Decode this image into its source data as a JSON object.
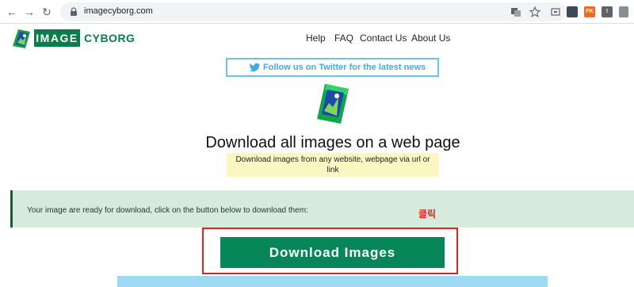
{
  "browser": {
    "url": "imagecyborg.com",
    "extensions": [
      {
        "name": "grammar-extension-icon",
        "label": "",
        "color": "#3c4a57"
      },
      {
        "name": "fk-extension-icon",
        "label": "FK",
        "color": "#f26b1d"
      },
      {
        "name": "info-extension-icon",
        "label": "!",
        "color": "#5f6368"
      },
      {
        "name": "shield-extension-icon",
        "label": "",
        "color": "#8a8d91"
      }
    ]
  },
  "site": {
    "logo_image": "IMAGE",
    "logo_cyborg": "CYBORG",
    "nav": [
      "Help",
      "FAQ",
      "Contact Us",
      "About Us"
    ]
  },
  "twitter": {
    "text": "Follow us on Twitter for the latest news"
  },
  "hero": {
    "title": "Download all images on a web page",
    "subtitle": "Download images from any website, webpage via url or link"
  },
  "alert": {
    "text": "Your image are ready for download, click on the button below to download them:"
  },
  "annotation": {
    "text": "클릭",
    "color": "#e0231e"
  },
  "download": {
    "label": "Download Images"
  },
  "colors": {
    "brand_green": "#0a7d4a",
    "button_green": "#068659",
    "twitter_blue": "#4aa8e0",
    "alert_bg": "#d7ebdd"
  }
}
